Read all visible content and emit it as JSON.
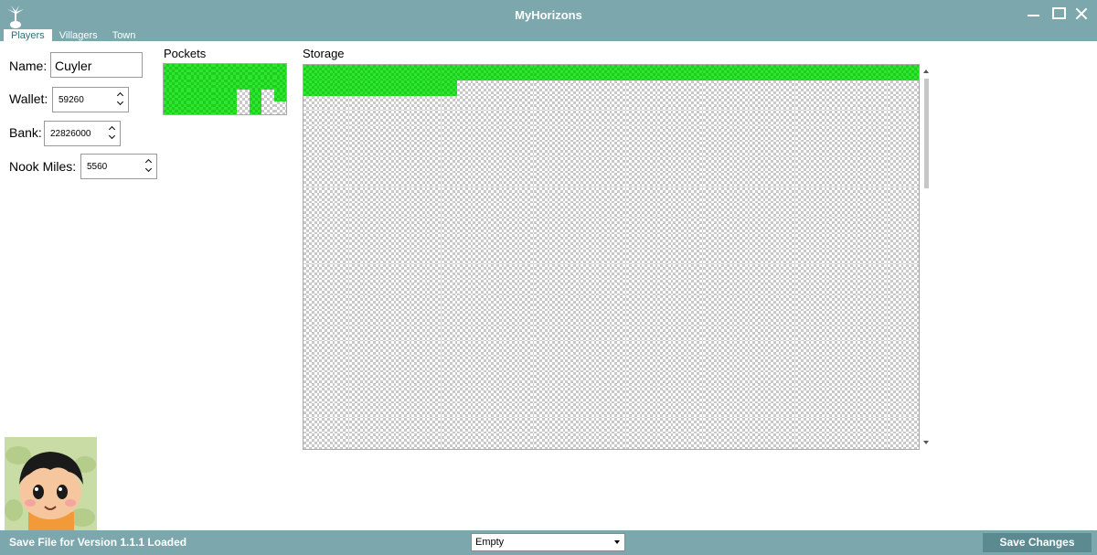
{
  "window": {
    "title": "MyHorizons",
    "icon": "palm-tree-icon"
  },
  "tabs": [
    {
      "label": "Players",
      "active": true
    },
    {
      "label": "Villagers",
      "active": false
    },
    {
      "label": "Town",
      "active": false
    }
  ],
  "player": {
    "name_label": "Name:",
    "name_value": "Cuyler",
    "wallet_label": "Wallet:",
    "wallet_value": "59260",
    "bank_label": "Bank:",
    "bank_value": "22826000",
    "nook_miles_label": "Nook Miles:",
    "nook_miles_value": "5560"
  },
  "pockets": {
    "title": "Pockets",
    "columns": 10,
    "rows": 4,
    "filled_slots": [
      0,
      1,
      2,
      3,
      4,
      5,
      6,
      7,
      8,
      9,
      10,
      11,
      12,
      13,
      14,
      15,
      16,
      17,
      18,
      19,
      20,
      21,
      22,
      23,
      24,
      25,
      27,
      29,
      30,
      31,
      32,
      33,
      34,
      35,
      37,
      40,
      42
    ]
  },
  "storage": {
    "title": "Storage",
    "columns": 40,
    "visible_rows": 25,
    "filled_count": 50
  },
  "statusbar": {
    "status_text": "Save File for Version 1.1.1 Loaded",
    "item_select_value": "Empty",
    "save_button_label": "Save Changes"
  },
  "colors": {
    "accent": "#7ba7ad",
    "filled_slot": "#2ee62e"
  }
}
